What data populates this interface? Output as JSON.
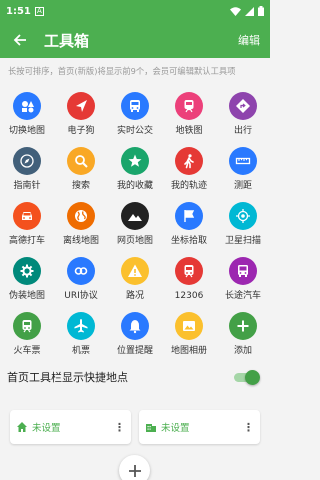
{
  "status": {
    "time": "1:51",
    "notif": "A"
  },
  "appbar": {
    "title": "工具箱",
    "edit_label": "编辑"
  },
  "hint": "长按可排序，首页(新版)将显示前9个，会员可编辑默认工具项",
  "tools": [
    {
      "label": "切换地图",
      "icon": "switch-map-icon",
      "color": "#2979ff"
    },
    {
      "label": "电子狗",
      "icon": "navigation-arrow-icon",
      "color": "#e53935"
    },
    {
      "label": "实时公交",
      "icon": "bus-icon",
      "color": "#2979ff"
    },
    {
      "label": "地铁图",
      "icon": "subway-icon",
      "color": "#ec407a"
    },
    {
      "label": "出行",
      "icon": "directions-icon",
      "color": "#8e44ad"
    },
    {
      "label": "指南针",
      "icon": "compass-icon",
      "color": "#42607a"
    },
    {
      "label": "搜索",
      "icon": "search-icon",
      "color": "#f9a825"
    },
    {
      "label": "我的收藏",
      "icon": "star-icon",
      "color": "#1aa56b"
    },
    {
      "label": "我的轨迹",
      "icon": "walking-icon",
      "color": "#e53935"
    },
    {
      "label": "测距",
      "icon": "ruler-icon",
      "color": "#2979ff"
    },
    {
      "label": "高德打车",
      "icon": "car-icon",
      "color": "#f4511e"
    },
    {
      "label": "离线地图",
      "icon": "globe-icon",
      "color": "#ef6c00"
    },
    {
      "label": "网页地图",
      "icon": "mountains-icon",
      "color": "#212121"
    },
    {
      "label": "坐标拾取",
      "icon": "flag-icon",
      "color": "#2979ff"
    },
    {
      "label": "卫星扫描",
      "icon": "satellite-icon",
      "color": "#00b8d4"
    },
    {
      "label": "伪装地图",
      "icon": "gear-icon",
      "color": "#00897b"
    },
    {
      "label": "URI协议",
      "icon": "link-icon",
      "color": "#2979ff"
    },
    {
      "label": "路况",
      "icon": "warning-icon",
      "color": "#fbc02d"
    },
    {
      "label": "12306",
      "icon": "train-icon",
      "color": "#e53935"
    },
    {
      "label": "长途汽车",
      "icon": "coach-icon",
      "color": "#9c27b0"
    },
    {
      "label": "火车票",
      "icon": "train-ticket-icon",
      "color": "#43a047"
    },
    {
      "label": "机票",
      "icon": "airplane-icon",
      "color": "#00b8d4"
    },
    {
      "label": "位置提醒",
      "icon": "bell-icon",
      "color": "#2979ff"
    },
    {
      "label": "地图相册",
      "icon": "photo-icon",
      "color": "#fbc02d"
    },
    {
      "label": "添加",
      "icon": "plus-icon",
      "color": "#43a047"
    }
  ],
  "quick_places": {
    "label": "首页工具栏显示快捷地点",
    "enabled": true,
    "home_label": "未设置",
    "work_label": "未设置"
  },
  "colors": {
    "primary": "#4caf50",
    "toggle": "#43a047"
  }
}
